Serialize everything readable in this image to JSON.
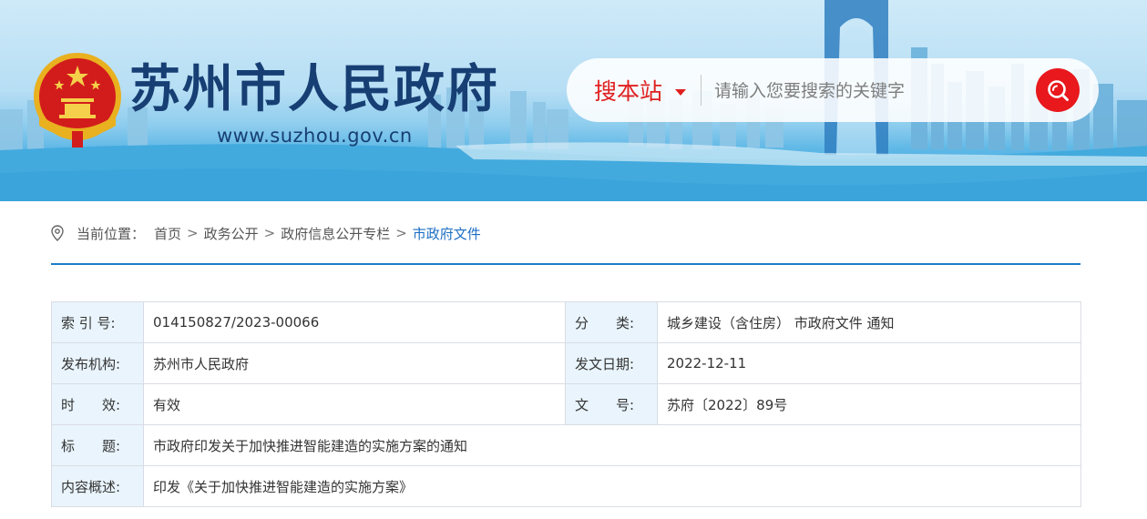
{
  "header": {
    "site_name": "苏州市人民政府",
    "site_url": "www.suzhou.gov.cn",
    "search": {
      "scope_label": "搜本站",
      "placeholder": "请输入您要搜索的关键字"
    }
  },
  "breadcrumb": {
    "prefix": "当前位置：",
    "items": [
      "首页",
      "政务公开",
      "政府信息公开专栏",
      "市政府文件"
    ],
    "separator": ">"
  },
  "info_table": {
    "index_label": "索 引 号:",
    "index_value": "014150827/2023-00066",
    "category_label": "分　　类:",
    "category_value": "城乡建设（含住房） 市政府文件 通知",
    "publisher_label": "发布机构:",
    "publisher_value": "苏州市人民政府",
    "date_label": "发文日期:",
    "date_value": "2022-12-11",
    "validity_label": "时　　效:",
    "validity_value": "有效",
    "doc_no_label": "文　　号:",
    "doc_no_value": "苏府〔2022〕89号",
    "title_label": "标　　题:",
    "title_value": "市政府印发关于加快推进智能建造的实施方案的通知",
    "summary_label": "内容概述:",
    "summary_value": "印发《关于加快推进智能建造的实施方案》"
  },
  "colors": {
    "brand_navy": "#173f74",
    "search_red": "#e8181d",
    "link_blue": "#1d6fc4",
    "rule_blue": "#1c7cc7",
    "label_bg": "#e9f4fc"
  },
  "icons": [
    "national-emblem-icon",
    "search-icon",
    "location-pin-icon",
    "caret-down-icon"
  ]
}
